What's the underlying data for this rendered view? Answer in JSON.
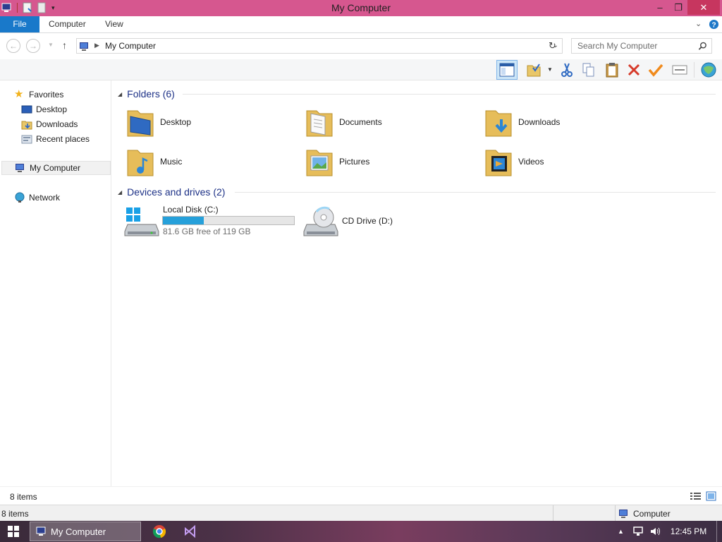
{
  "window": {
    "title": "My Computer"
  },
  "ribbon": {
    "tabs": [
      "File",
      "Computer",
      "View"
    ]
  },
  "address": {
    "path": "My Computer"
  },
  "search": {
    "placeholder": "Search My Computer"
  },
  "sidebar": {
    "favorites_label": "Favorites",
    "favorites": [
      "Desktop",
      "Downloads",
      "Recent places"
    ],
    "computer_label": "My Computer",
    "network_label": "Network"
  },
  "content": {
    "folders_header": "Folders (6)",
    "folders": [
      "Desktop",
      "Documents",
      "Downloads",
      "Music",
      "Pictures",
      "Videos"
    ],
    "drives_header": "Devices and drives (2)",
    "drives": [
      {
        "name": "Local Disk (C:)",
        "free_text": "81.6 GB free of 119 GB",
        "used_fraction": 0.314
      },
      {
        "name": "CD Drive (D:)"
      }
    ]
  },
  "status": {
    "items_count": "8 items",
    "bottom_items": "8 items",
    "location": "Computer"
  },
  "taskbar": {
    "active_window": "My Computer",
    "clock": "12:45 PM"
  },
  "colors": {
    "titlebar": "#d6578f",
    "close_button": "#c7365f",
    "file_tab": "#1979ca",
    "group_header": "#1e3287",
    "capacity_fill": "#26a0da"
  }
}
